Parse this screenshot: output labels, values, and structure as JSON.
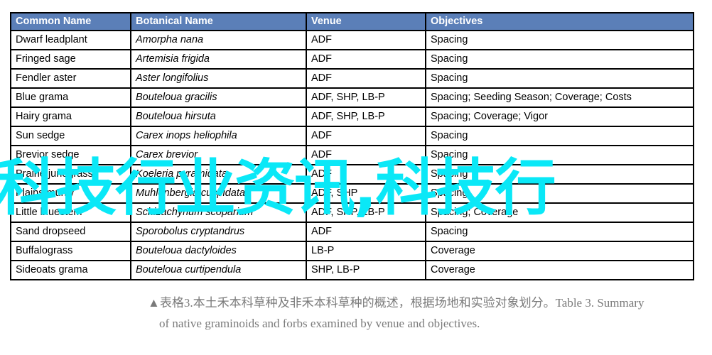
{
  "figure": {
    "title": "Table 3. Summary of native graminoids and forbs examined by venue and objectives",
    "accent_header_color": "#5b7fb8",
    "watermark_color": "#0ae8f7",
    "border_color": "#000000",
    "caption_color": "#7a7a7a"
  },
  "table": {
    "headers": {
      "common": "Common Name",
      "botanical": "Botanical  Name",
      "venue": "Venue",
      "objectives": "Objectives"
    },
    "rows": [
      {
        "common": "Dwarf leadplant",
        "botanical": "Amorpha nana",
        "venue": "ADF",
        "objectives": "Spacing"
      },
      {
        "common": "Fringed sage",
        "botanical": "Artemisia frigida",
        "venue": "ADF",
        "objectives": "Spacing"
      },
      {
        "common": "Fendler aster",
        "botanical": "Aster longifolius",
        "venue": "ADF",
        "objectives": "Spacing"
      },
      {
        "common": "Blue grama",
        "botanical": "Bouteloua gracilis",
        "venue": "ADF, SHP, LB-P",
        "objectives": "Spacing; Seeding Season;  Coverage; Costs"
      },
      {
        "common": "Hairy grama",
        "botanical": "Bouteloua hirsuta",
        "venue": "ADF, SHP, LB-P",
        "objectives": "Spacing; Coverage; Vigor"
      },
      {
        "common": "Sun sedge",
        "botanical": "Carex inops heliophila",
        "venue": "ADF",
        "objectives": "Spacing"
      },
      {
        "common": "Brevior sedge",
        "botanical": "Carex brevior",
        "venue": "ADF",
        "objectives": "Spacing"
      },
      {
        "common": "Prairie junegrass",
        "botanical": "Koeleria pyramidata",
        "venue": "ADF",
        "objectives": "Spacing"
      },
      {
        "common": "Plains muhly",
        "botanical": "Muhlenbergia cuspidata",
        "venue": "ADF, SHP",
        "objectives": "Spacing"
      },
      {
        "common": "Little bluestem",
        "botanical": "Schizachyrium scoparium",
        "venue": "ADF, SHP, LB-P",
        "objectives": "Spacing; Coverage"
      },
      {
        "common": "Sand dropseed",
        "botanical": "Sporobolus cryptandrus",
        "venue": "ADF",
        "objectives": "Spacing"
      },
      {
        "common": "Buffalograss",
        "botanical": "Bouteloua dactyloides",
        "venue": "LB-P",
        "objectives": "Coverage"
      },
      {
        "common": "Sideoats grama",
        "botanical": "Bouteloua curtipendula",
        "venue": "SHP, LB-P",
        "objectives": "Coverage"
      }
    ]
  },
  "caption": {
    "line1": "▲表格3.本土禾本科草种及非禾本科草种的概述，根据场地和实验对象划分。Table 3. Summary",
    "line2": "of native graminoids and forbs examined by venue and objectives."
  },
  "watermark": {
    "text": "科技行业资讯,科技行"
  }
}
